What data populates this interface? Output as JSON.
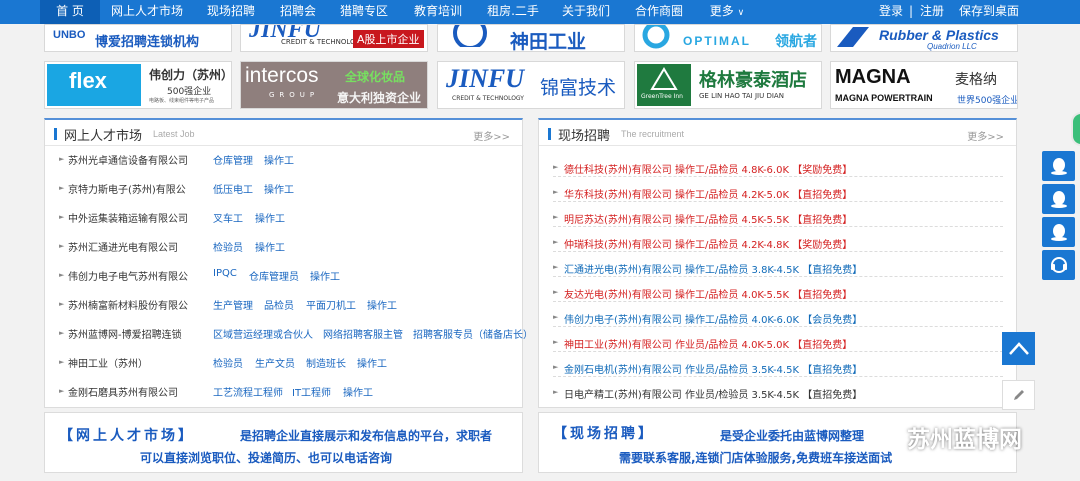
{
  "nav": {
    "items": [
      {
        "label": "首 页"
      },
      {
        "label": "网上人才市场"
      },
      {
        "label": "现场招聘"
      },
      {
        "label": "招聘会"
      },
      {
        "label": "猎聘专区"
      },
      {
        "label": "教育培训"
      },
      {
        "label": "租房.二手"
      },
      {
        "label": "关于我们"
      },
      {
        "label": "合作商圈"
      },
      {
        "label": "更多"
      }
    ],
    "login": "登录",
    "divider": "|",
    "register": "注册",
    "save_desktop": "保存到桌面"
  },
  "logos": {
    "row1": [
      {
        "brand": "UNBO",
        "name": "博爱招聘连锁机构"
      },
      {
        "brand": "JINFU",
        "sub": "CREDIT & TECHNOLOGY",
        "tag": "A股上市企业"
      },
      {
        "name": "神田工业"
      },
      {
        "brand": "OPTIMAL",
        "name": "领航者"
      },
      {
        "brand": "Rubber & Plastics",
        "sub": "Quadrion LLC"
      }
    ],
    "row2": [
      {
        "brand": "flex",
        "name": "伟创力（苏州）",
        "line1": "500强企业",
        "line2": "电路板、线束组件等电子产品"
      },
      {
        "brand": "intercos",
        "sub": "GROUP",
        "line1": "全球化妆品",
        "line2": "意大利独资企业"
      },
      {
        "brand": "JINFU",
        "sub": "CREDIT & TECHNOLOGY",
        "name": "锦富技术"
      },
      {
        "name": "格林豪泰酒店",
        "sub": "GE LIN HAO TAI JIU DIAN",
        "brand": "GreenTree Inn"
      },
      {
        "brand": "MAGNA",
        "name": "麦格纳",
        "sub": "MAGNA POWERTRAIN",
        "tag": "世界500强企业"
      }
    ]
  },
  "market": {
    "title": "网上人才市场",
    "subtitle": "Latest Job",
    "more": "更多>>",
    "rows": [
      {
        "company": "苏州光卓通信设备有限公司",
        "jobs": [
          "仓库管理",
          "操作工"
        ]
      },
      {
        "company": "京特力斯电子(苏州)有限公",
        "jobs": [
          "低压电工",
          "操作工"
        ]
      },
      {
        "company": "中外运集装箱运输有限公司",
        "jobs": [
          "叉车工",
          "操作工"
        ]
      },
      {
        "company": "苏州汇通进光电有限公司",
        "jobs": [
          "检验员",
          "操作工"
        ]
      },
      {
        "company": "伟创力电子电气苏州有限公",
        "jobs": [
          "IPQC",
          "仓库管理员",
          "操作工"
        ]
      },
      {
        "company": "苏州楠富新材料股份有限公",
        "jobs": [
          "生产管理",
          "品检员",
          "平面刀机工",
          "操作工"
        ]
      },
      {
        "company": "苏州蓝博网-博爱招聘连锁",
        "jobs": [
          "区域营运经理或合伙人",
          "网络招聘客服主管",
          "招聘客服专员（储备店长）"
        ]
      },
      {
        "company": "神田工业（苏州）",
        "jobs": [
          "检验员",
          "生产文员",
          "制造班长",
          "操作工"
        ]
      },
      {
        "company": "金刚石磨具苏州有限公司",
        "jobs": [
          "工艺流程工程师",
          "IT工程师",
          "操作工"
        ]
      }
    ]
  },
  "recruit": {
    "title": "现场招聘",
    "subtitle": "The recruitment",
    "more": "更多>>",
    "rows": [
      {
        "text": "德仕科技(苏州)有限公司 操作工/品检员 4.8K-6.0K 【奖励免费】",
        "color": "#d42020"
      },
      {
        "text": "华东科技(苏州)有限公司 操作工/品检员 4.2K-5.0K 【直招免费】",
        "color": "#d42020"
      },
      {
        "text": "明尼苏达(苏州)有限公司 操作工/品检员 4.5K-5.5K 【直招免费】",
        "color": "#d42020"
      },
      {
        "text": "仲瑞科技(苏州)有限公司 操作工/品检员 4.2K-4.8K 【奖励免费】",
        "color": "#d42020"
      },
      {
        "text": "汇通进光电(苏州)有限公司 操作工/品检员 3.8K-4.5K 【直招免费】",
        "color": "#0f6ab8"
      },
      {
        "text": "友达光电(苏州)有限公司 操作工/品检员 4.0K-5.5K 【直招免费】",
        "color": "#d42020"
      },
      {
        "text": "伟创力电子(苏州)有限公司 操作工/品检员 4.0K-6.0K 【会员免费】",
        "color": "#0f6ab8"
      },
      {
        "text": "神田工业(苏州)有限公司 作业员/品检员 4.0K-5.0K 【直招免费】",
        "color": "#d42020"
      },
      {
        "text": "金刚石电机(苏州)有限公司 作业员/品检员 3.5K-4.5K 【直招免费】",
        "color": "#0f6ab8"
      },
      {
        "text": "日电产精工(苏州)有限公司 作业员/检验员 3.5K-4.5K 【直招免费】",
        "color": "#333333"
      }
    ]
  },
  "banners": {
    "left": {
      "title": "【网上人才市场】",
      "line1": "是招聘企业直接展示和发布信息的平台，求职者",
      "line2": "可以直接浏览职位、投递简历、也可以电话咨询"
    },
    "right": {
      "title": "【现场招聘】",
      "line1": "是受企业委托由蓝博网整理",
      "line2": "需要联系客服,连锁门店体验服务,免费班车接送面试"
    }
  },
  "watermark": "苏州蓝博网",
  "colors": {
    "nav": "#1a77d2",
    "link": "#1a67c0",
    "red": "#d42020",
    "bannerBlue": "#1a5bbf"
  }
}
